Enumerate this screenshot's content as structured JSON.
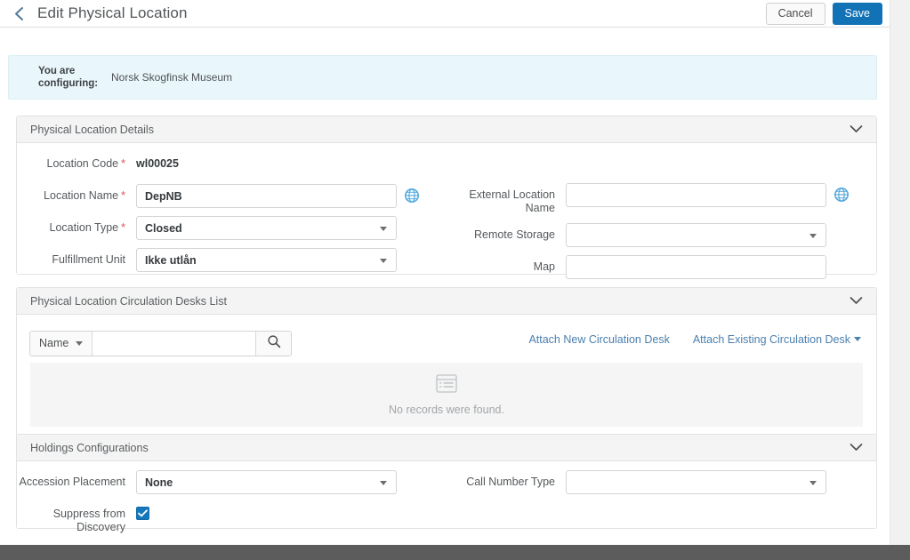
{
  "header": {
    "back_icon": "chevron-left-icon",
    "title": "Edit Physical Location",
    "cancel_label": "Cancel",
    "save_label": "Save"
  },
  "banner": {
    "label": "You are configuring:",
    "value": "Norsk Skogfinsk Museum"
  },
  "panels": {
    "details": {
      "title": "Physical Location Details",
      "toggle_icon": "chevron-down-icon",
      "fields": {
        "location_code": {
          "label": "Location Code",
          "required": true,
          "value": "wl00025"
        },
        "location_name": {
          "label": "Location Name",
          "required": true,
          "value": "DepNB",
          "placeholder": "",
          "globe_icon": "globe-icon"
        },
        "location_type": {
          "label": "Location Type",
          "required": true,
          "value": "Closed"
        },
        "fulfillment_unit": {
          "label": "Fulfillment Unit",
          "required": false,
          "value": "Ikke utlån"
        },
        "external_location_name": {
          "label": "External Location Name",
          "required": false,
          "value": "",
          "placeholder": "",
          "globe_icon": "globe-icon"
        },
        "remote_storage": {
          "label": "Remote Storage",
          "required": false,
          "value": ""
        },
        "map": {
          "label": "Map",
          "required": false,
          "value": "",
          "placeholder": ""
        }
      }
    },
    "circ_desks": {
      "title": "Physical Location Circulation Desks List",
      "toggle_icon": "chevron-down-icon",
      "search": {
        "scope_label": "Name",
        "scope_caret_icon": "caret-down-icon",
        "value": "",
        "placeholder": "",
        "search_icon": "search-icon"
      },
      "links": [
        {
          "label": "Attach New Circulation Desk",
          "has_caret": false
        },
        {
          "label": "Attach Existing Circulation Desk",
          "has_caret": true
        }
      ],
      "empty": {
        "icon": "list-records-icon",
        "text": "No records were found."
      }
    },
    "holdings": {
      "title": "Holdings Configurations",
      "toggle_icon": "chevron-down-icon",
      "fields": {
        "accession_placement": {
          "label": "Accession Placement",
          "required": false,
          "value": "None"
        },
        "suppress_from_discovery": {
          "label": "Suppress from Discovery",
          "checked": true,
          "check_icon": "checkmark-icon"
        },
        "call_number_type": {
          "label": "Call Number Type",
          "required": false,
          "value": ""
        }
      }
    }
  },
  "colors": {
    "accent_blue": "#1272b6",
    "link_blue": "#4a7fae",
    "required_red": "#d9534f",
    "banner_bg": "#e9f6fb",
    "panel_head_bg": "#f4f4f4",
    "footer_bar": "#5c5c5c"
  }
}
